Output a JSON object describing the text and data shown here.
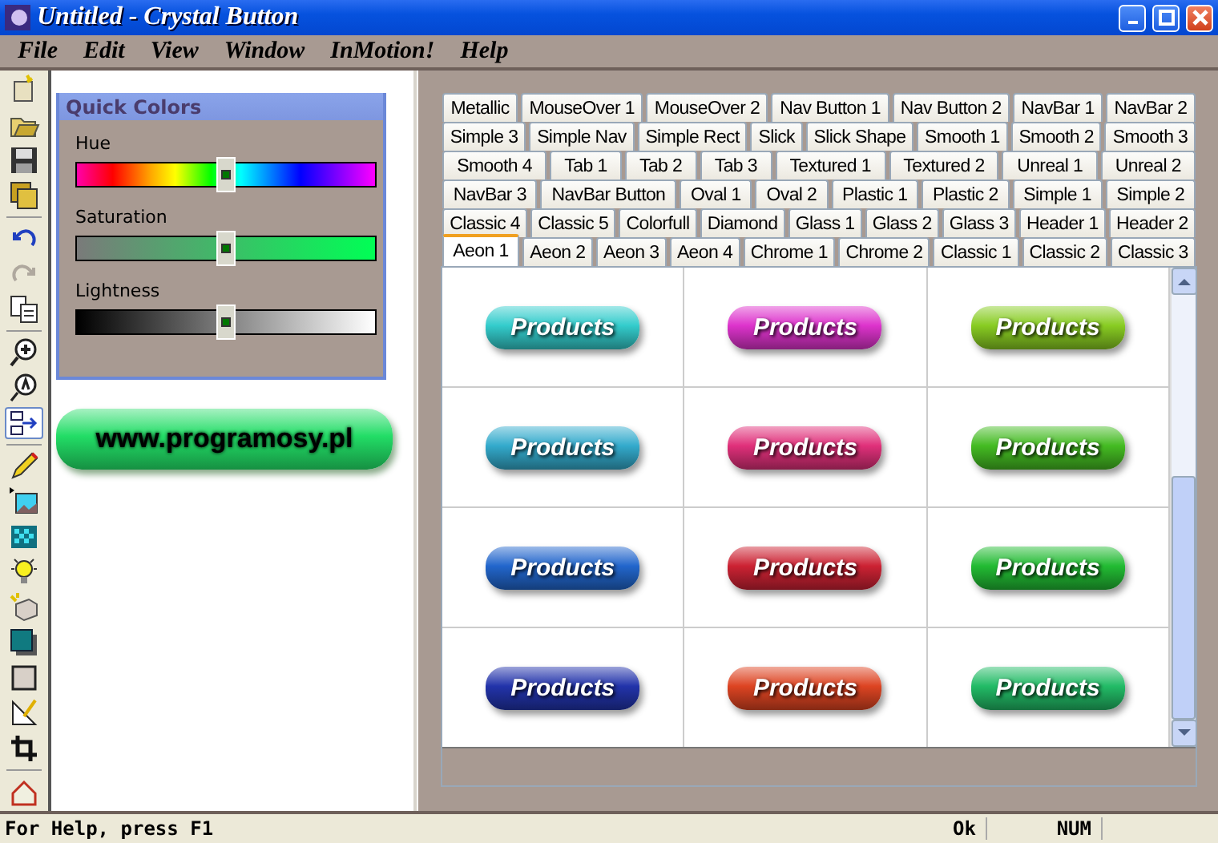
{
  "window": {
    "title": "Untitled - Crystal Button"
  },
  "menu": [
    "File",
    "Edit",
    "View",
    "Window",
    "InMotion!",
    "Help"
  ],
  "toolbar": [
    {
      "kind": "new",
      "disabled": false,
      "pressed": false
    },
    {
      "kind": "open",
      "disabled": false,
      "pressed": false
    },
    {
      "kind": "save",
      "disabled": false,
      "pressed": false
    },
    {
      "kind": "saveall",
      "disabled": false,
      "pressed": false
    },
    {
      "kind": "sep"
    },
    {
      "kind": "undo",
      "disabled": false,
      "pressed": false
    },
    {
      "kind": "redo",
      "disabled": true,
      "pressed": false
    },
    {
      "kind": "copy",
      "disabled": false,
      "pressed": false
    },
    {
      "kind": "sep"
    },
    {
      "kind": "zoomin",
      "disabled": false,
      "pressed": false
    },
    {
      "kind": "zoomtext",
      "disabled": false,
      "pressed": false
    },
    {
      "kind": "link",
      "disabled": false,
      "pressed": true
    },
    {
      "kind": "sep"
    },
    {
      "kind": "pencil",
      "disabled": false,
      "pressed": false
    },
    {
      "kind": "image",
      "disabled": false,
      "pressed": false
    },
    {
      "kind": "pattern",
      "disabled": false,
      "pressed": false
    },
    {
      "kind": "bulb",
      "disabled": false,
      "pressed": false
    },
    {
      "kind": "box",
      "disabled": false,
      "pressed": false
    },
    {
      "kind": "shadow",
      "disabled": false,
      "pressed": false
    },
    {
      "kind": "rect",
      "disabled": false,
      "pressed": false
    },
    {
      "kind": "ruler",
      "disabled": false,
      "pressed": false
    },
    {
      "kind": "crop",
      "disabled": false,
      "pressed": false
    },
    {
      "kind": "sep"
    },
    {
      "kind": "home",
      "disabled": false,
      "pressed": false
    }
  ],
  "quick_colors": {
    "title": "Quick Colors",
    "sliders": [
      {
        "kind": "hue",
        "label": "Hue",
        "level": 0.5
      },
      {
        "kind": "saturation",
        "label": "Saturation",
        "level": 0.5
      },
      {
        "kind": "lightness",
        "label": "Lightness",
        "level": 0.5
      }
    ]
  },
  "preview_button": {
    "label": "www.programosy.pl",
    "color": "#22dd66"
  },
  "tab_rows": [
    [
      {
        "label": "Metallic",
        "selected": false
      },
      {
        "label": "MouseOver 1",
        "selected": false
      },
      {
        "label": "MouseOver 2",
        "selected": false
      },
      {
        "label": "Nav Button 1",
        "selected": false
      },
      {
        "label": "Nav Button 2",
        "selected": false
      },
      {
        "label": "NavBar 1",
        "selected": false
      },
      {
        "label": "NavBar 2",
        "selected": false
      }
    ],
    [
      {
        "label": "Simple 3",
        "selected": false
      },
      {
        "label": "Simple Nav",
        "selected": false
      },
      {
        "label": "Simple Rect",
        "selected": false
      },
      {
        "label": "Slick",
        "selected": false
      },
      {
        "label": "Slick Shape",
        "selected": false
      },
      {
        "label": "Smooth 1",
        "selected": false
      },
      {
        "label": "Smooth 2",
        "selected": false
      },
      {
        "label": "Smooth 3",
        "selected": false
      }
    ],
    [
      {
        "label": "Smooth 4",
        "selected": false
      },
      {
        "label": "Tab 1",
        "selected": false
      },
      {
        "label": "Tab 2",
        "selected": false
      },
      {
        "label": "Tab 3",
        "selected": false
      },
      {
        "label": "Textured 1",
        "selected": false
      },
      {
        "label": "Textured 2",
        "selected": false
      },
      {
        "label": "Unreal 1",
        "selected": false
      },
      {
        "label": "Unreal 2",
        "selected": false
      }
    ],
    [
      {
        "label": "NavBar 3",
        "selected": false
      },
      {
        "label": "NavBar Button",
        "selected": false
      },
      {
        "label": "Oval 1",
        "selected": false
      },
      {
        "label": "Oval 2",
        "selected": false
      },
      {
        "label": "Plastic 1",
        "selected": false
      },
      {
        "label": "Plastic 2",
        "selected": false
      },
      {
        "label": "Simple 1",
        "selected": false
      },
      {
        "label": "Simple 2",
        "selected": false
      }
    ],
    [
      {
        "label": "Classic 4",
        "selected": false
      },
      {
        "label": "Classic 5",
        "selected": false
      },
      {
        "label": "Colorfull",
        "selected": false
      },
      {
        "label": "Diamond",
        "selected": false
      },
      {
        "label": "Glass 1",
        "selected": false
      },
      {
        "label": "Glass 2",
        "selected": false
      },
      {
        "label": "Glass 3",
        "selected": false
      },
      {
        "label": "Header 1",
        "selected": false
      },
      {
        "label": "Header 2",
        "selected": false
      }
    ],
    [
      {
        "label": "Aeon 1",
        "selected": true
      },
      {
        "label": "Aeon 2",
        "selected": false
      },
      {
        "label": "Aeon 3",
        "selected": false
      },
      {
        "label": "Aeon 4",
        "selected": false
      },
      {
        "label": "Chrome 1",
        "selected": false
      },
      {
        "label": "Chrome 2",
        "selected": false
      },
      {
        "label": "Classic 1",
        "selected": false
      },
      {
        "label": "Classic 2",
        "selected": false
      },
      {
        "label": "Classic 3",
        "selected": false
      }
    ]
  ],
  "samples": [
    {
      "label": "Products",
      "color": "#33cccc"
    },
    {
      "label": "Products",
      "color": "#dd33cc"
    },
    {
      "label": "Products",
      "color": "#88cc22"
    },
    {
      "label": "Products",
      "color": "#33aacc"
    },
    {
      "label": "Products",
      "color": "#e0307a"
    },
    {
      "label": "Products",
      "color": "#44bb22"
    },
    {
      "label": "Products",
      "color": "#2266cc"
    },
    {
      "label": "Products",
      "color": "#cc2233"
    },
    {
      "label": "Products",
      "color": "#22bb33"
    },
    {
      "label": "Products",
      "color": "#2233aa"
    },
    {
      "label": "Products",
      "color": "#dd4422"
    },
    {
      "label": "Products",
      "color": "#22bb66"
    }
  ],
  "status_bar": {
    "message": "For Help, press F1",
    "panels": [
      "Ok",
      "NUM"
    ]
  }
}
